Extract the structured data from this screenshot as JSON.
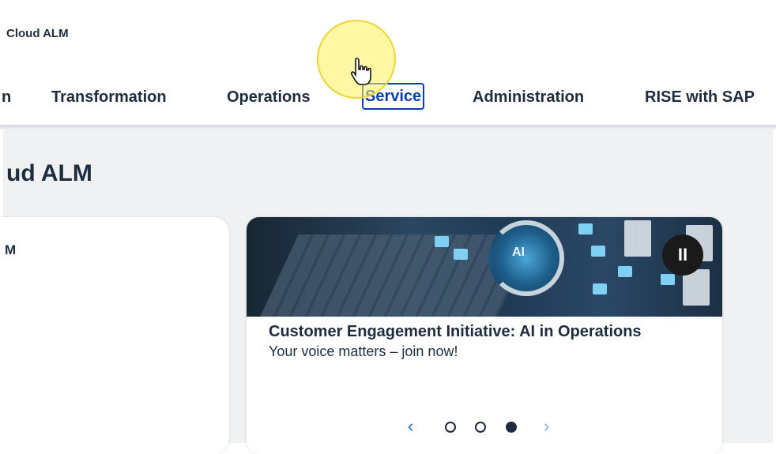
{
  "shell": {
    "title": "Cloud ALM"
  },
  "nav": {
    "items": [
      {
        "label": "n"
      },
      {
        "label": "Transformation"
      },
      {
        "label": "Operations"
      },
      {
        "label": "Service"
      },
      {
        "label": "Administration"
      },
      {
        "label": "RISE with SAP"
      }
    ]
  },
  "page": {
    "title": "ud ALM"
  },
  "left_card": {
    "title": "M"
  },
  "carousel": {
    "banner_badge": "AI",
    "pause_symbol": "II",
    "heading": "Customer Engagement Initiative: AI in Operations",
    "subtext": "Your voice matters – join now!",
    "prev_symbol": "‹",
    "next_symbol": "›",
    "pages": 3,
    "active_page": 3
  },
  "colors": {
    "accent": "#0a3fb4",
    "link": "#0a6ed1",
    "text": "#1d2d3e",
    "background": "#eff1f3"
  }
}
